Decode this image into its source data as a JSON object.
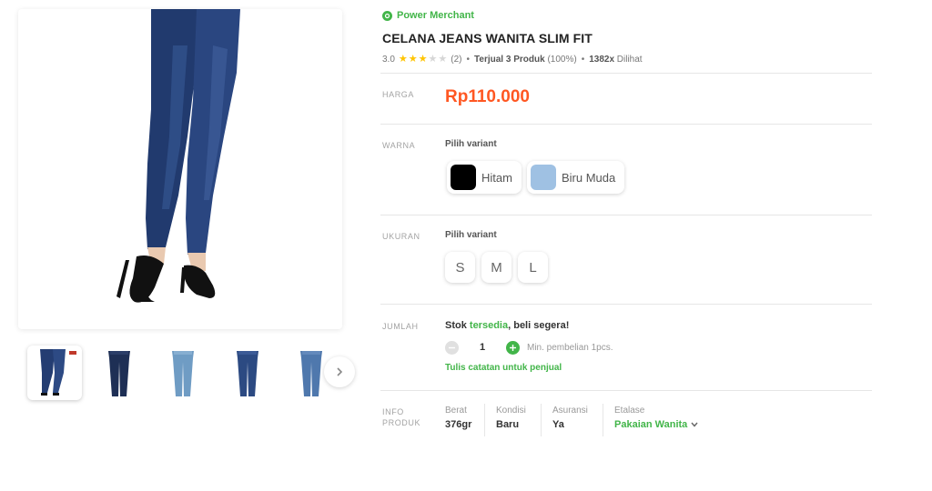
{
  "gallery": {
    "main_image": "product-photo-jeans-legs",
    "thumbnails": [
      {
        "name": "thumb-1",
        "active": true
      },
      {
        "name": "thumb-2",
        "active": false
      },
      {
        "name": "thumb-3",
        "active": false
      },
      {
        "name": "thumb-4",
        "active": false
      },
      {
        "name": "thumb-5",
        "active": false
      }
    ],
    "next_icon": "chevron-right-icon"
  },
  "seller": {
    "badge_label": "Power Merchant",
    "badge_icon": "power-merchant-icon",
    "badge_color": "#42b549"
  },
  "product": {
    "title": "CELANA JEANS WANITA SLIM FIT",
    "rating_value": "3.0",
    "rating_stars": 3,
    "rating_max": 5,
    "review_count": "(2)",
    "sold_label": "Terjual 3 Produk",
    "sold_percent": "(100%)",
    "view_count": "1382x",
    "view_label": "Dilihat",
    "separator": "•"
  },
  "price": {
    "label": "HARGA",
    "value": "Rp110.000",
    "color": "#ff5722"
  },
  "color_variant": {
    "label": "WARNA",
    "prompt": "Pilih variant",
    "options": [
      {
        "label": "Hitam",
        "swatch": "#000000"
      },
      {
        "label": "Biru Muda",
        "swatch": "#9fc1e3"
      }
    ]
  },
  "size_variant": {
    "label": "UKURAN",
    "prompt": "Pilih variant",
    "options": [
      "S",
      "M",
      "L"
    ]
  },
  "quantity": {
    "label": "JUMLAH",
    "stock_prefix": "Stok ",
    "stock_status": "tersedia",
    "stock_suffix": ", beli segera!",
    "value": "1",
    "min_text": "Min. pembelian 1pcs.",
    "note_link": "Tulis catatan untuk penjual",
    "minus_icon": "minus-circle-icon",
    "plus_icon": "plus-circle-icon"
  },
  "product_info": {
    "label_line1": "INFO",
    "label_line2": "PRODUK",
    "weight_label": "Berat",
    "weight_value": "376gr",
    "condition_label": "Kondisi",
    "condition_value": "Baru",
    "insurance_label": "Asuransi",
    "insurance_value": "Ya",
    "etalase_label": "Etalase",
    "etalase_value": "Pakaian Wanita",
    "etalase_icon": "chevron-down-icon"
  }
}
